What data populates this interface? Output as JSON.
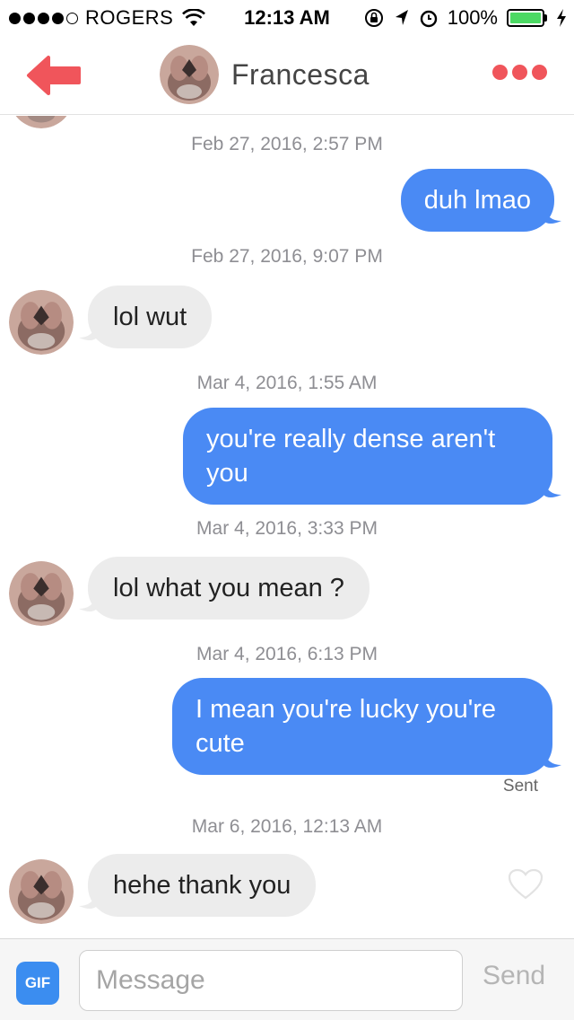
{
  "status_bar": {
    "carrier": "ROGERS",
    "time": "12:13 AM",
    "battery_pct": "100%",
    "battery_level": 1.0,
    "signal_bars": 4,
    "battery_color": "#4cd964"
  },
  "header": {
    "name": "Francesca",
    "back_icon": "back-arrow-icon",
    "more_icon": "more-dots-icon",
    "accent_color": "#f0555b"
  },
  "thread": {
    "messages": [
      {
        "timestamp": "Feb 27, 2016, 2:57 PM",
        "direction": "outgoing",
        "lines": [
          "duh lmao"
        ]
      },
      {
        "timestamp": "Feb 27, 2016, 9:07 PM",
        "direction": "incoming",
        "lines": [
          "lol wut"
        ]
      },
      {
        "timestamp": "Mar 4, 2016, 1:55 AM",
        "direction": "outgoing",
        "lines": [
          "you're really dense aren't",
          "you"
        ]
      },
      {
        "timestamp": "Mar 4, 2016, 3:33 PM",
        "direction": "incoming",
        "lines": [
          "lol what you mean ?"
        ]
      },
      {
        "timestamp": "Mar 4, 2016, 6:13 PM",
        "direction": "outgoing",
        "lines": [
          "I mean you're lucky you're",
          "cute"
        ]
      },
      {
        "timestamp": "Mar 6, 2016, 12:13 AM",
        "direction": "incoming",
        "lines": [
          "hehe thank you"
        ]
      }
    ],
    "sent_label": "Sent",
    "outgoing_color": "#4a8af4",
    "incoming_color": "#ececec"
  },
  "composer": {
    "gif_label": "GIF",
    "placeholder": "Message",
    "value": "",
    "send_label": "Send"
  }
}
